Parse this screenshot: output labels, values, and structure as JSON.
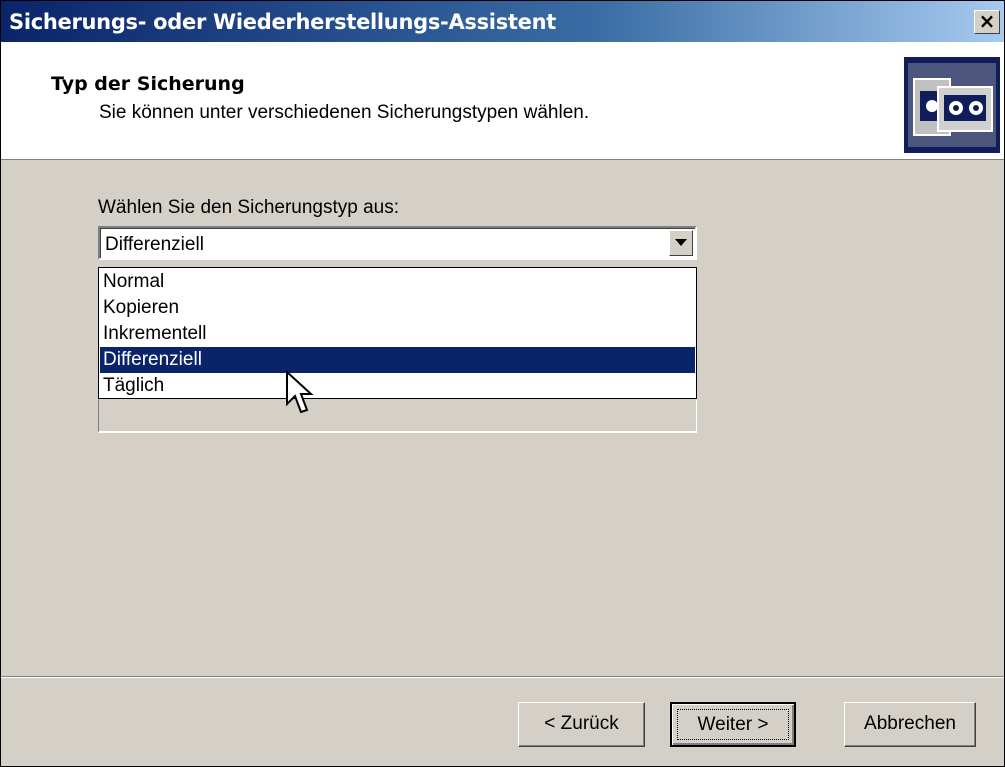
{
  "window": {
    "title": "Sicherungs- oder Wiederherstellungs-Assistent",
    "close_glyph": "×"
  },
  "header": {
    "title": "Typ der Sicherung",
    "subtitle": "Sie können unter verschiedenen Sicherungstypen wählen.",
    "icon": "backup-tape-icon"
  },
  "form": {
    "label": "Wählen Sie den Sicherungstyp aus:",
    "selected": "Differenziell",
    "options": [
      "Normal",
      "Kopieren",
      "Inkrementell",
      "Differenziell",
      "Täglich"
    ]
  },
  "buttons": {
    "back": "< Zurück",
    "next": "Weiter >",
    "cancel": "Abbrechen"
  },
  "colors": {
    "title_bar_start": "#0a246a",
    "title_bar_end": "#a6caf0",
    "selection": "#0a246a",
    "dialog_face": "#d4d0c8",
    "header_icon_bg": "#0f1e5a"
  }
}
